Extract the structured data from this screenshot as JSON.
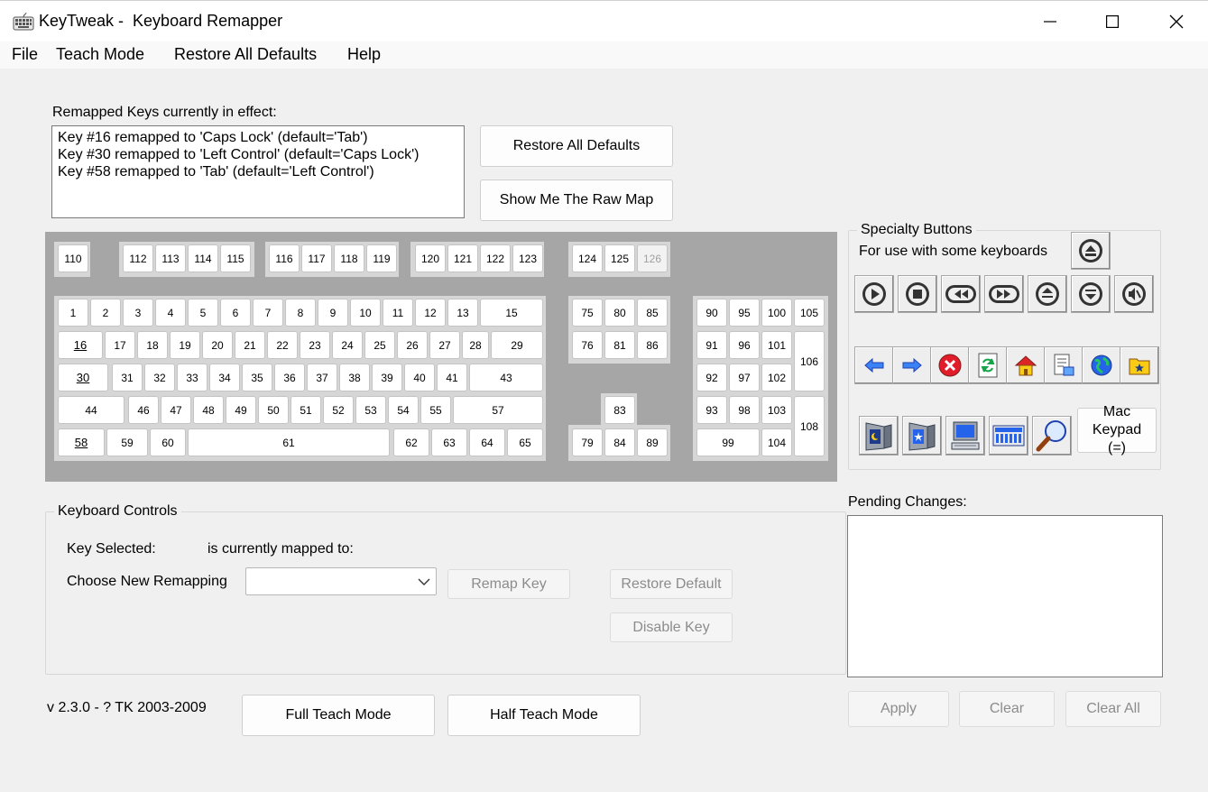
{
  "window": {
    "title": "KeyTweak -  Keyboard Remapper",
    "minimize_glyph": "—",
    "maximize_glyph": "☐",
    "close_glyph": "✕"
  },
  "menu": [
    "File",
    "Teach Mode",
    "Restore All Defaults",
    "Help"
  ],
  "remapped": {
    "label": "Remapped Keys currently in effect:",
    "items": [
      "Key #16 remapped to 'Caps Lock' (default='Tab')",
      "Key #30 remapped to 'Left Control' (default='Caps Lock')",
      "Key #58 remapped to 'Tab' (default='Left Control')"
    ]
  },
  "buttons": {
    "restore_all_defaults": "Restore All Defaults",
    "show_raw_map": "Show Me The Raw Map",
    "full_teach_mode": "Full Teach Mode",
    "half_teach_mode": "Half Teach Mode",
    "remap_key": "Remap Key",
    "restore_default": "Restore Default",
    "disable_key": "Disable Key",
    "apply": "Apply",
    "clear": "Clear",
    "clear_all": "Clear All"
  },
  "keyboard": {
    "function_row": [
      "110",
      "112",
      "113",
      "114",
      "115",
      "116",
      "117",
      "118",
      "119",
      "120",
      "121",
      "122",
      "123",
      "124",
      "125",
      "126"
    ],
    "row1": [
      "1",
      "2",
      "3",
      "4",
      "5",
      "6",
      "7",
      "8",
      "9",
      "10",
      "11",
      "12",
      "13",
      "15"
    ],
    "row2": [
      "16",
      "17",
      "18",
      "19",
      "20",
      "21",
      "22",
      "23",
      "24",
      "25",
      "26",
      "27",
      "28",
      "29"
    ],
    "row3": [
      "30",
      "31",
      "32",
      "33",
      "34",
      "35",
      "36",
      "37",
      "38",
      "39",
      "40",
      "41",
      "43"
    ],
    "row4": [
      "44",
      "46",
      "47",
      "48",
      "49",
      "50",
      "51",
      "52",
      "53",
      "54",
      "55",
      "57"
    ],
    "row5": [
      "58",
      "59",
      "60",
      "61",
      "62",
      "63",
      "64",
      "65"
    ],
    "nav": [
      "75",
      "80",
      "85",
      "76",
      "81",
      "86",
      "83",
      "79",
      "84",
      "89"
    ],
    "numpad": [
      "90",
      "95",
      "100",
      "105",
      "91",
      "96",
      "101",
      "106",
      "92",
      "97",
      "102",
      "93",
      "98",
      "103",
      "108",
      "99",
      "104"
    ],
    "mapped_keys": [
      "16",
      "30",
      "58"
    ],
    "disabled_keys": [
      "126"
    ]
  },
  "specialty": {
    "title": "Specialty Buttons",
    "subtitle": "For use with some keyboards",
    "mac_keypad": "Mac Keypad (=)",
    "icons": [
      "eject-icon",
      "play-icon",
      "stop-icon",
      "rewind-icon",
      "fast-forward-icon",
      "volume-up-icon",
      "volume-down-icon",
      "mute-icon",
      "back-arrow-icon",
      "forward-arrow-icon",
      "stop-browser-icon",
      "refresh-icon",
      "home-icon",
      "search-page-icon",
      "web-globe-icon",
      "favorites-icon",
      "sleep-monitor-icon",
      "wake-monitor-icon",
      "my-computer-icon",
      "calculator-icon",
      "magnifier-icon"
    ]
  },
  "controls": {
    "title": "Keyboard Controls",
    "key_selected": "Key Selected:",
    "currently_mapped": "is currently mapped to:",
    "choose_new": "Choose New Remapping"
  },
  "pending": {
    "label": "Pending Changes:"
  },
  "version": "v 2.3.0 - ? TK 2003-2009",
  "colors": {
    "panel": "#a6a6a6",
    "key_group": "#d6d6d6",
    "window_bg": "#f0f0f0"
  }
}
